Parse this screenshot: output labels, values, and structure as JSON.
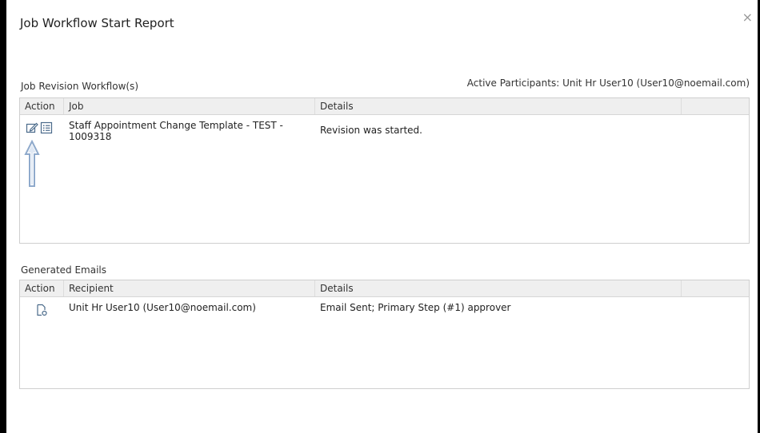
{
  "dialog": {
    "title": "Job Workflow Start Report",
    "close_glyph": "×"
  },
  "revision": {
    "section_label": "Job Revision Workflow(s)",
    "participants": "Active Participants: Unit Hr User10 (User10@noemail.com)",
    "columns": {
      "action": "Action",
      "job": "Job",
      "details": "Details"
    },
    "rows": [
      {
        "job_line1": "Staff Appointment Change Template - TEST -",
        "job_line2": "1009318",
        "details": "Revision was started.",
        "action_icons": [
          "edit-icon",
          "list-icon"
        ]
      }
    ]
  },
  "emails": {
    "section_label": "Generated Emails",
    "columns": {
      "action": "Action",
      "recipient": "Recipient",
      "details": "Details"
    },
    "rows": [
      {
        "recipient": "Unit Hr User10 (User10@noemail.com)",
        "details": "Email Sent; Primary Step (#1) approver",
        "action_icons": [
          "email-document-icon"
        ]
      }
    ]
  },
  "annotation": {
    "icon": "up-arrow-icon",
    "color": "#8faacc"
  }
}
